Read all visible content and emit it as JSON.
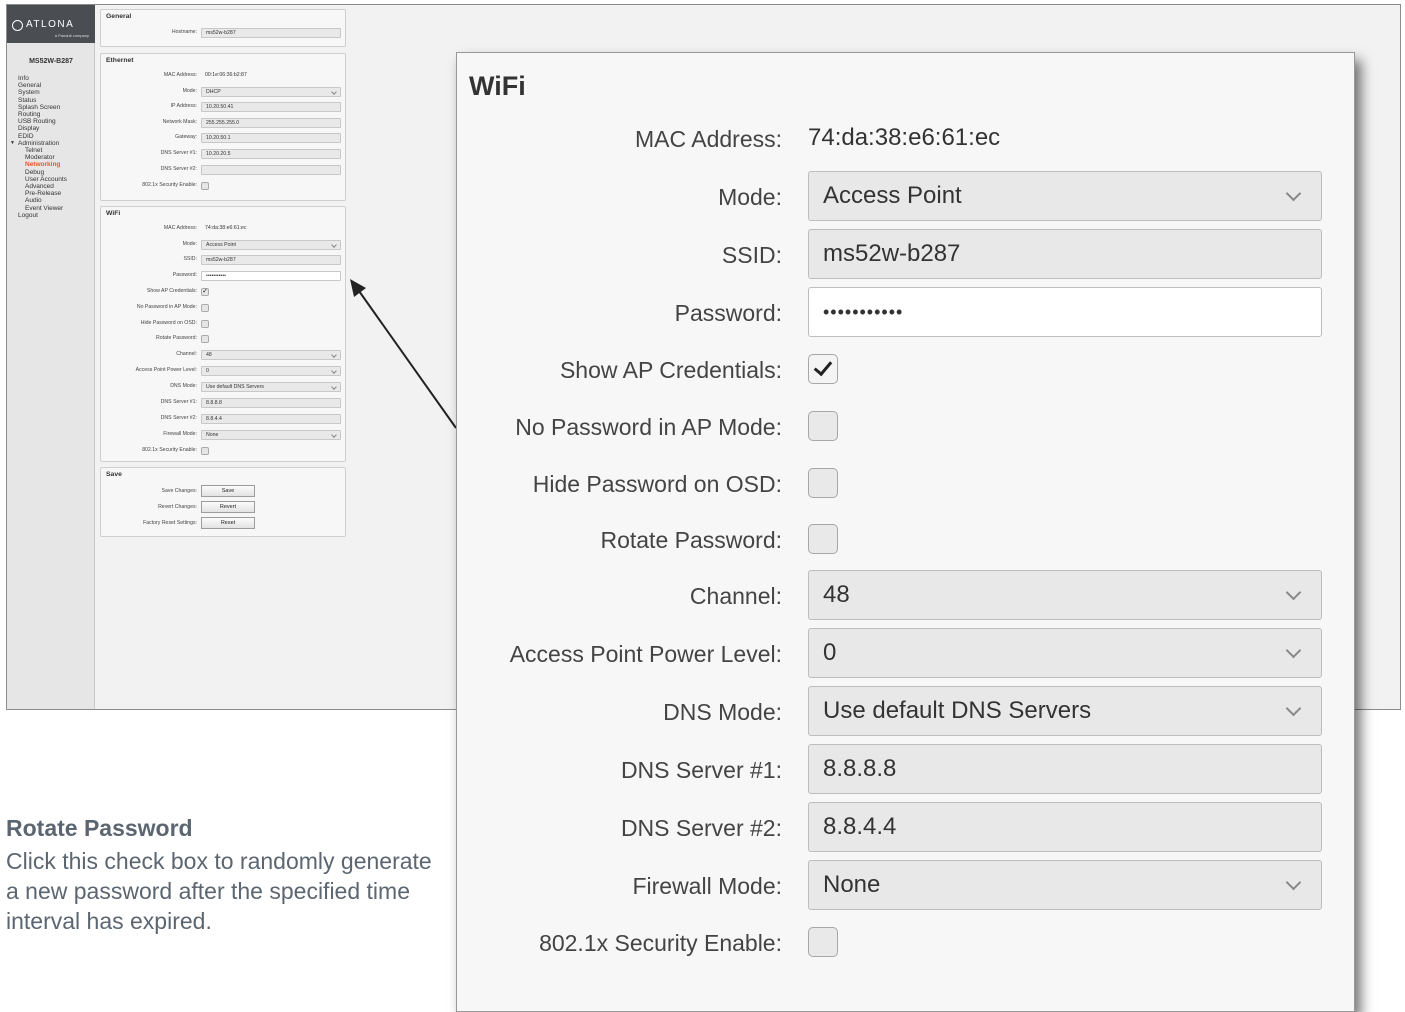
{
  "sidebar": {
    "logo": "ATLONA",
    "logo_sub": "a Panduit company",
    "device_name": "MS52W-B287",
    "items": [
      {
        "label": "Info"
      },
      {
        "label": "General"
      },
      {
        "label": "System"
      },
      {
        "label": "Status"
      },
      {
        "label": "Splash Screen"
      },
      {
        "label": "Routing"
      },
      {
        "label": "USB Routing"
      },
      {
        "label": "Display"
      },
      {
        "label": "EDID"
      },
      {
        "label": "Administration"
      },
      {
        "label": "Telnet"
      },
      {
        "label": "Moderator"
      },
      {
        "label": "Networking"
      },
      {
        "label": "Debug"
      },
      {
        "label": "User Accounts"
      },
      {
        "label": "Advanced"
      },
      {
        "label": "Pre-Release"
      },
      {
        "label": "Audio"
      },
      {
        "label": "Event Viewer"
      },
      {
        "label": "Logout"
      }
    ]
  },
  "general": {
    "title": "General",
    "hostname_label": "Hostname:",
    "hostname_value": "ms52w-b287"
  },
  "ethernet": {
    "title": "Ethernet",
    "mac_label": "MAC Address:",
    "mac_value": "00:1e:06:36:b2:87",
    "mode_label": "Mode:",
    "mode_value": "DHCP",
    "ip_label": "IP Address:",
    "ip_value": "10.20.50.41",
    "mask_label": "Network Mask:",
    "mask_value": "255.255.255.0",
    "gateway_label": "Gateway:",
    "gateway_value": "10.20.50.1",
    "dns1_label": "DNS Server #1:",
    "dns1_value": "10.20.20.5",
    "dns2_label": "DNS Server #2:",
    "dns2_value": "",
    "security_label": "802.1x Security Enable:"
  },
  "wifi": {
    "title": "WiFi",
    "mac_label": "MAC Address:",
    "mac_value": "74:da:38:e6:61:ec",
    "mode_label": "Mode:",
    "mode_value": "Access Point",
    "ssid_label": "SSID:",
    "ssid_value": "ms52w-b287",
    "password_label": "Password:",
    "password_value": "•••••••••••",
    "show_ap_label": "Show AP Credentials:",
    "show_ap_checked": true,
    "no_password_label": "No Password in AP Mode:",
    "no_password_checked": false,
    "hide_password_label": "Hide Password on OSD:",
    "hide_password_checked": false,
    "rotate_label": "Rotate Password:",
    "rotate_checked": false,
    "channel_label": "Channel:",
    "channel_value": "48",
    "power_label": "Access Point Power Level:",
    "power_value": "0",
    "dns_mode_label": "DNS Mode:",
    "dns_mode_value": "Use default DNS Servers",
    "dns1_label": "DNS Server #1:",
    "dns1_value": "8.8.8.8",
    "dns2_label": "DNS Server #2:",
    "dns2_value": "8.8.4.4",
    "firewall_label": "Firewall Mode:",
    "firewall_value": "None",
    "security_label": "802.1x Security Enable:",
    "security_checked": false
  },
  "save": {
    "title": "Save",
    "save_label": "Save Changes:",
    "save_button": "Save",
    "revert_label": "Revert Changes:",
    "revert_button": "Revert",
    "reset_label": "Factory Reset Settings:",
    "reset_button": "Reset"
  },
  "caption": {
    "title": "Rotate Password",
    "body": "Click this check box to randomly generate a new password after the specified time interval has expired."
  }
}
